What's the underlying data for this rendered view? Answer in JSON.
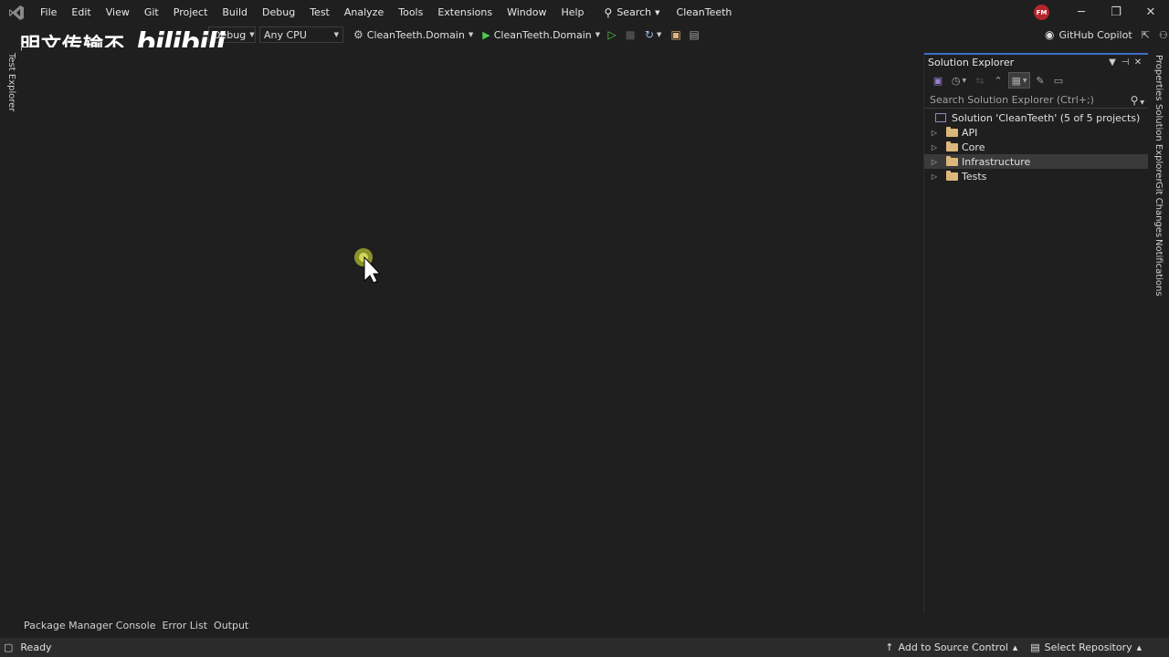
{
  "menubar": {
    "items": [
      "File",
      "Edit",
      "View",
      "Git",
      "Project",
      "Build",
      "Debug",
      "Test",
      "Analyze",
      "Tools",
      "Extensions",
      "Window",
      "Help"
    ],
    "search_label": "Search",
    "solution_name": "CleanTeeth",
    "user_initials": "FM"
  },
  "toolbar": {
    "configuration": "Debug",
    "platform": "Any CPU",
    "startup_project": "CleanTeeth.Domain",
    "run_target": "CleanTeeth.Domain",
    "copilot_label": "GitHub Copilot"
  },
  "watermark": {
    "text": "明文传输不",
    "logo": "bilibili"
  },
  "left_strip": {
    "tabs": [
      "Test Explorer"
    ]
  },
  "solution_explorer": {
    "title": "Solution Explorer",
    "search_placeholder": "Search Solution Explorer (Ctrl+;)",
    "solution_label": "Solution 'CleanTeeth' (5 of 5 projects)",
    "folders": [
      {
        "name": "API",
        "selected": false
      },
      {
        "name": "Core",
        "selected": false
      },
      {
        "name": "Infrastructure",
        "selected": true
      },
      {
        "name": "Tests",
        "selected": false
      }
    ]
  },
  "right_strip": {
    "tabs": [
      "Properties",
      "Solution Explorer",
      "Git Changes",
      "Notifications"
    ]
  },
  "bottom_tabs": [
    "Package Manager Console",
    "Error List",
    "Output"
  ],
  "statusbar": {
    "ready": "Ready",
    "source_control": "Add to Source Control",
    "select_repository": "Select Repository"
  },
  "icons": {
    "logo": "visual-studio-icon",
    "run": "play-icon",
    "search": "search-icon"
  },
  "colors": {
    "accent": "#3b6fc7",
    "run_green": "#4ec94e",
    "folder": "#dcb67a",
    "avatar": "#b3262b"
  }
}
